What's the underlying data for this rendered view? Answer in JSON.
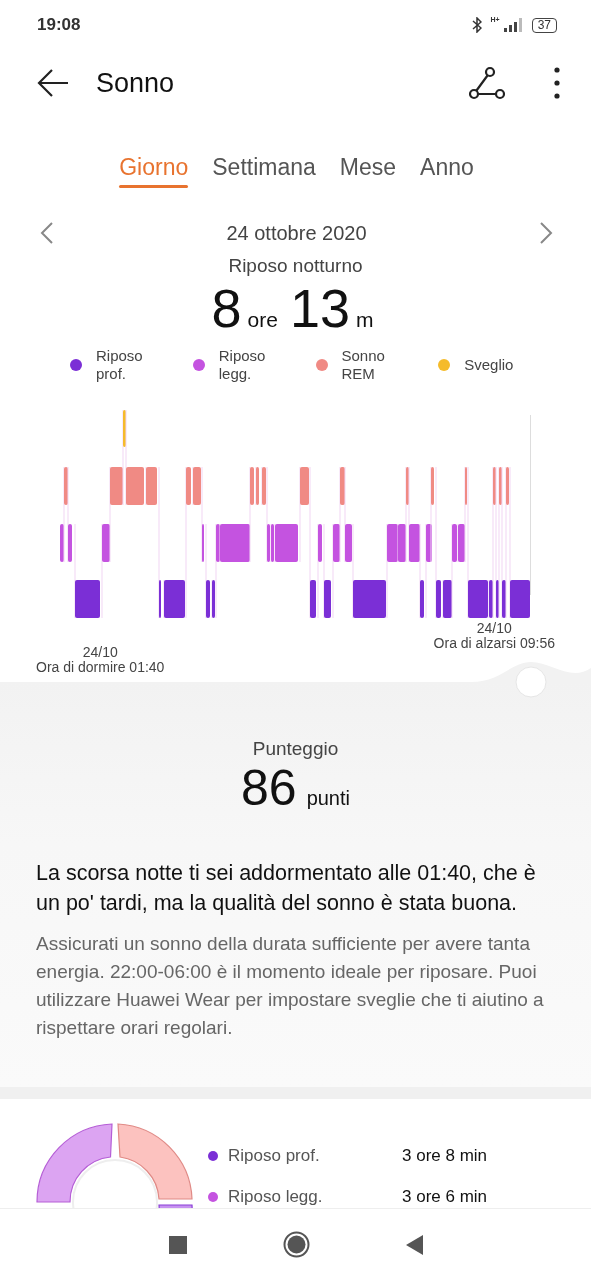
{
  "status_bar": {
    "time": "19:08",
    "network": "H+",
    "battery": "37"
  },
  "header": {
    "title": "Sonno"
  },
  "tabs": [
    {
      "label": "Giorno",
      "selected": true
    },
    {
      "label": "Settimana",
      "selected": false
    },
    {
      "label": "Mese",
      "selected": false
    },
    {
      "label": "Anno",
      "selected": false
    }
  ],
  "date_nav": {
    "date": "24 ottobre 2020"
  },
  "summary": {
    "title": "Riposo notturno",
    "hours": "8",
    "hours_unit": "ore",
    "minutes": "13",
    "minutes_unit": "m"
  },
  "legend": [
    {
      "label": "Riposo prof.",
      "color": "#7b2fd6"
    },
    {
      "label": "Riposo legg.",
      "color": "#c453e0"
    },
    {
      "label": "Sonno REM",
      "color": "#f08a84"
    },
    {
      "label": "Sveglio",
      "color": "#f5bb2a"
    }
  ],
  "chart": {
    "end_date": "24/10",
    "end_label": "Ora di alzarsi 09:56",
    "start_date": "24/10",
    "start_label": "Ora di dormire 01:40"
  },
  "score": {
    "title": "Punteggio",
    "value": "86",
    "unit": "punti"
  },
  "assessment": "La scorsa notte ti sei addormentato alle 01:40, che è un po' tardi, ma la qualità del sonno è stata buona.",
  "advice": "Assicurati un sonno della durata sufficiente per avere tanta energia. 22:00-06:00 è il momento ideale per riposare. Puoi utilizzare Huawei Wear per impostare sveglie che ti aiutino a rispettare orari regolari.",
  "breakdown": [
    {
      "label": "Riposo prof.",
      "value": "3 ore 8 min",
      "color": "#7b2fd6"
    },
    {
      "label": "Riposo legg.",
      "value": "3 ore 6 min",
      "color": "#c453e0"
    }
  ]
}
